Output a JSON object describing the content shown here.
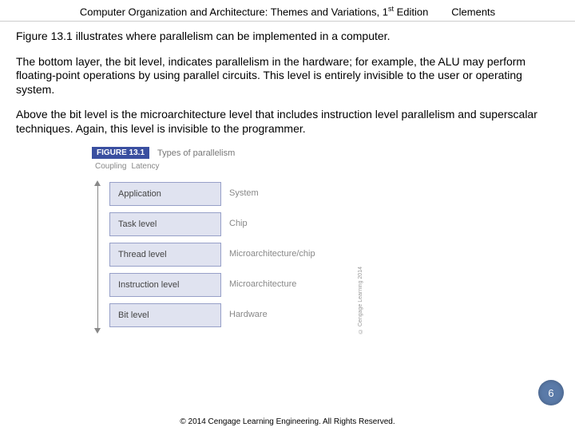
{
  "header": {
    "title_left": "Computer Organization and Architecture: Themes and Variations, 1",
    "title_sup": "st",
    "title_right": " Edition",
    "author": "Clements"
  },
  "paragraphs": {
    "p1": "Figure 13.1 illustrates where parallelism can be implemented in a computer.",
    "p2": "The bottom layer, the bit level, indicates parallelism in the hardware; for example, the ALU may perform floating-point operations by using parallel circuits. This level is entirely invisible to the user or operating system.",
    "p3": "Above the bit level is the microarchitecture level that includes instruction level parallelism and superscalar techniques. Again, this level is invisible to the programmer."
  },
  "figure": {
    "label": "FIGURE 13.1",
    "title": "Types of parallelism",
    "axis": {
      "left": "Coupling",
      "right": "Latency"
    },
    "rows": [
      {
        "left": "Application",
        "right": "System"
      },
      {
        "left": "Task level",
        "right": "Chip"
      },
      {
        "left": "Thread level",
        "right": "Microarchitecture/chip"
      },
      {
        "left": "Instruction level",
        "right": "Microarchitecture"
      },
      {
        "left": "Bit level",
        "right": "Hardware"
      }
    ],
    "credit": "© Cengage Learning 2014"
  },
  "page_number": "6",
  "footer": "© 2014 Cengage Learning Engineering. All Rights Reserved."
}
